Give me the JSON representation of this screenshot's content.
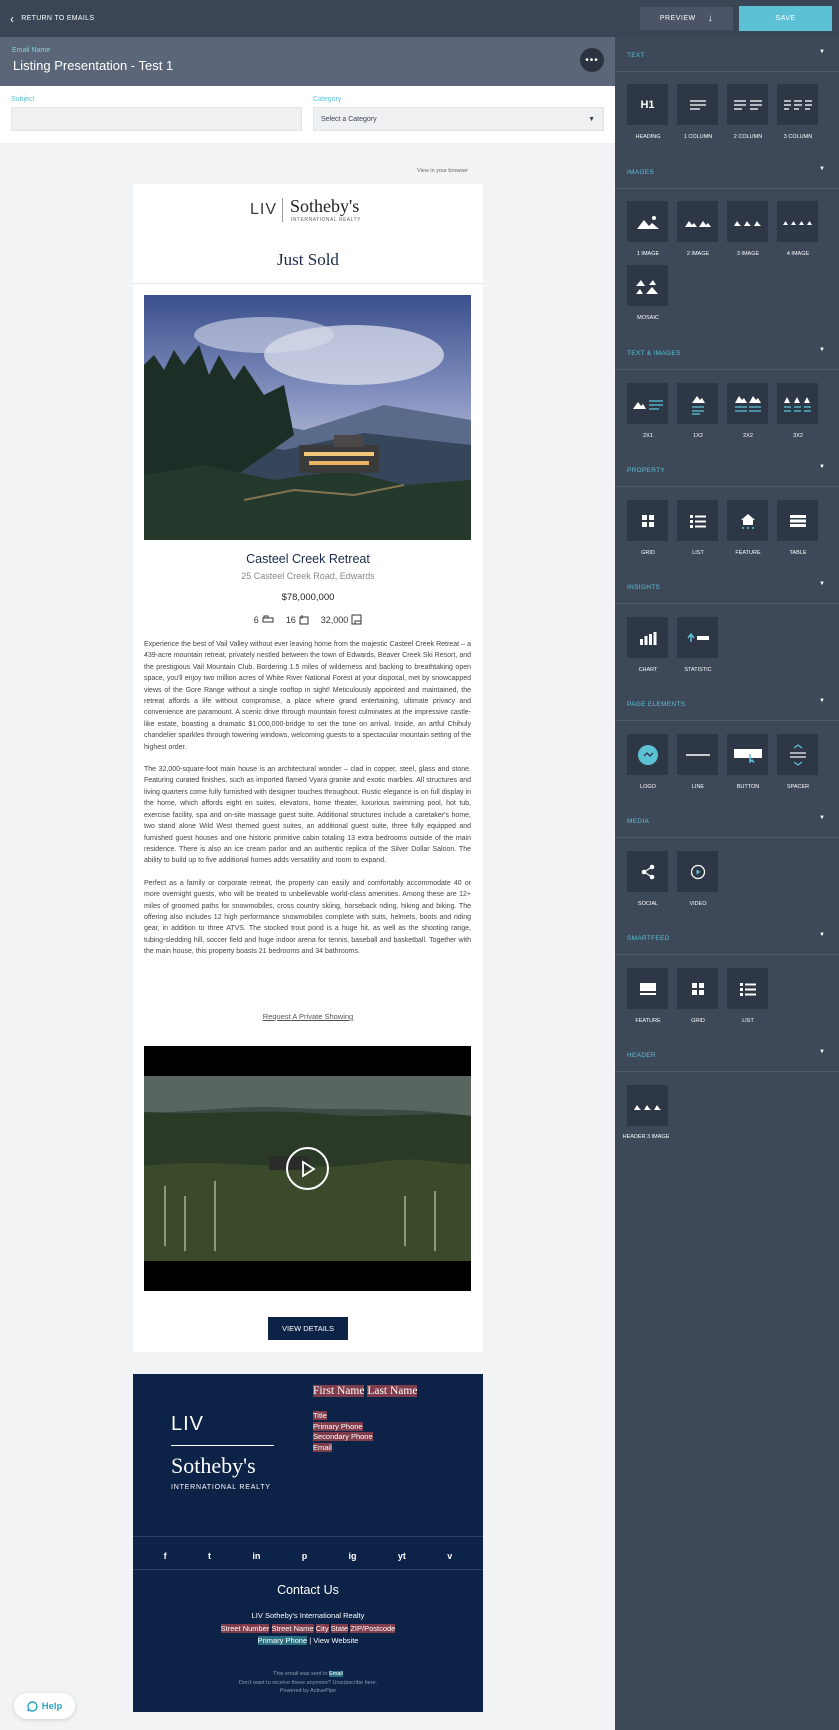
{
  "topbar": {
    "return_label": "RETURN TO EMAILS",
    "preview_label": "PREVIEW",
    "save_label": "SAVE"
  },
  "email_name": {
    "label": "Email Name",
    "value": "Listing Presentation - Test 1"
  },
  "fields": {
    "subject_label": "Subject",
    "subject_value": "",
    "category_label": "Category",
    "category_value": "Select a Category"
  },
  "canvas": {
    "view_in_browser": "View in your browser",
    "logo_liv": "LIV",
    "logo_sothebys": "Sotheby's",
    "logo_intl": "INTERNATIONAL REALTY",
    "headline": "Just Sold",
    "property": {
      "title": "Casteel Creek Retreat",
      "address": "25 Casteel Creek Road, Edwards",
      "price": "$78,000,000",
      "beds": "6",
      "baths": "16",
      "sqft": "32,000"
    },
    "description": [
      "Experience the best of Vail Valley without ever leaving home from the majestic Casteel Creek Retreat – a 439-acre mountain retreat, privately nestled between the town of Edwards, Beaver Creek Ski Resort, and the prestigious Vail Mountain Club. Bordering 1.5 miles of wilderness and backing to breathtaking open space, you'll enjoy two million acres of White River National Forest at your disposal, met by snowcapped views of the Gore Range without a single rooftop in sight! Meticulously appointed and maintained, the retreat affords a life without compromise, a place where grand entertaining, ultimate privacy and convenience are paramount. A scenic drive through mountain forest culminates at the impressive castle-like estate, boasting a dramatic $1,000,000-bridge to set the tone on arrival. Inside, an artful Chihuly chandelier sparkles through towering windows, welcoming guests to a spectacular mountain setting of the highest order.",
      "The 32,000-square-foot main house is an architectural wonder – clad in copper, steel, glass and stone. Featuring curated finishes, such as imported flamed Vyara granite and exotic marbles. All structures and living quarters come fully furnished with designer touches throughout. Rustic elegance is on full display in the home, which affords eight en suites, elevators, home theater, luxurious swimming pool, hot tub, exercise facility, spa and on-site massage guest suite. Additional structures include a caretaker's home, two stand alone Wild West themed guest suites, an additional guest suite, three fully equipped and furnished guest houses and one historic primitive cabin totaling 13 extra bedrooms outside of the main residence. There is also an ice cream parlor and an authentic replica of the Silver Dollar Saloon. The ability to build up to five additional homes adds versatility and room to expand.",
      "Perfect as a family or corporate retreat, the property can easily and comfortably accommodate 40 or more overnight guests, who will be treated to unbelievable world-class amenities. Among these are 12+ miles of groomed paths for snowmobiles, cross country skiing, horseback riding, hiking and biking. The offering also includes 12 high performance snowmobiles complete with suits, helmets, boots and riding gear, in addition to three ATVS. The stocked trout pond is a huge hit, as well as the shooting range, tubing-sledding hill, soccer field and huge indoor arena for tennis, baseball and basketball. Together with the main house, this property boasts 21 bedrooms and 34 bathrooms."
    ],
    "request_link": "Request A Private Showing",
    "view_details": "VIEW DETAILS"
  },
  "footer": {
    "liv": "LIV",
    "sothebys": "Sotheby's",
    "intl": "INTERNATIONAL REALTY",
    "first_name": "First Name",
    "last_name": "Last Name",
    "title": "Title",
    "primary_phone": "Primary Phone",
    "secondary_phone": "Secondary Phone",
    "email": "Email",
    "socials": [
      "f",
      "t",
      "in",
      "p",
      "ig",
      "yt",
      "v"
    ],
    "contact_title": "Contact Us",
    "company": "LIV Sotheby's International Realty",
    "street_number": "Street Number",
    "street_name": "Street Name",
    "city": "City",
    "state": "State",
    "zip": "ZIP/Postcode",
    "phone2": "Primary Phone",
    "view_website": "| View Website",
    "fine1": "This email was sent to",
    "fine1_hl": "Email",
    "fine2": "Don't want to receive these anymore? Unsubscribe here.",
    "fine3": "Powered by ActivePipe"
  },
  "help_label": "Help",
  "sidebar": {
    "sections": [
      {
        "title": "TEXT",
        "items": [
          "HEADING",
          "1 COLUMN",
          "2 COLUMN",
          "3 COLUMN"
        ]
      },
      {
        "title": "IMAGES",
        "items": [
          "1 IMAGE",
          "2 IMAGE",
          "3 IMAGE",
          "4 IMAGE",
          "MOSAIC"
        ]
      },
      {
        "title": "TEXT & IMAGES",
        "items": [
          "2X1",
          "1X2",
          "2X2",
          "3X2"
        ]
      },
      {
        "title": "PROPERTY",
        "items": [
          "GRID",
          "LIST",
          "FEATURE",
          "TABLE"
        ]
      },
      {
        "title": "INSIGHTS",
        "items": [
          "CHART",
          "STATISTIC"
        ]
      },
      {
        "title": "PAGE ELEMENTS",
        "items": [
          "LOGO",
          "LINE",
          "BUTTON",
          "SPACER"
        ]
      },
      {
        "title": "MEDIA",
        "items": [
          "SOCIAL",
          "VIDEO"
        ]
      },
      {
        "title": "SMARTFEED",
        "items": [
          "FEATURE",
          "GRID",
          "LIST"
        ]
      },
      {
        "title": "HEADER",
        "items": [
          "HEADER 3 IMAGE"
        ]
      }
    ],
    "heading_glyph": "H1",
    "chevron": "▼"
  },
  "colors": {
    "topbar": "#3a4555",
    "accent": "#5dc1d6",
    "sidebar": "#3d4859",
    "navy": "#0c2247"
  }
}
